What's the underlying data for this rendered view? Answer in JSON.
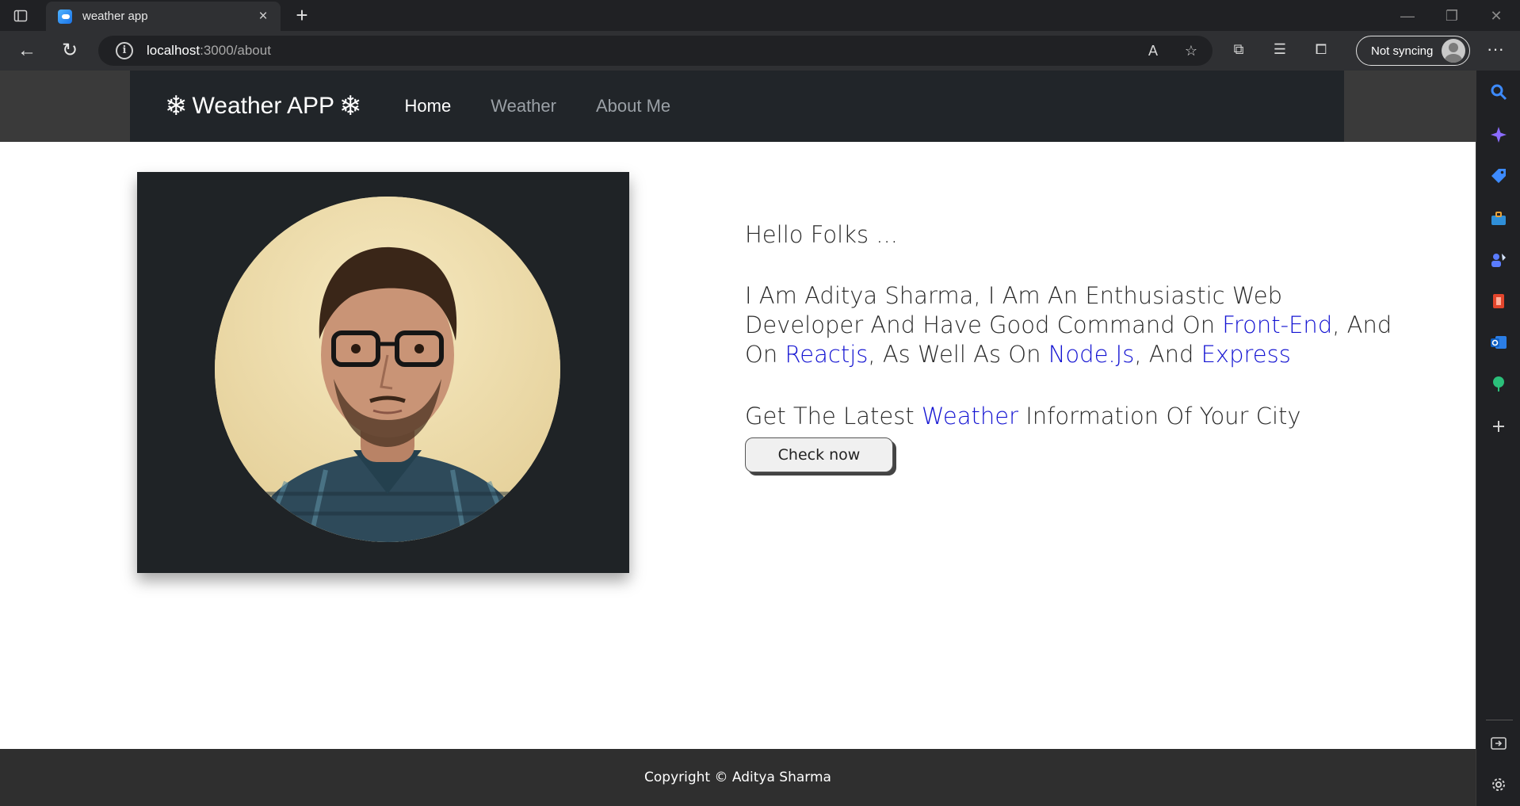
{
  "browser": {
    "tab_title": "weather app",
    "tab_close": "×",
    "new_tab": "+",
    "url_host": "localhost",
    "url_path": ":3000/about",
    "sync_label": "Not syncing",
    "more": "···"
  },
  "navbar": {
    "brand_flake": "❄",
    "brand_title": "Weather APP",
    "links": [
      {
        "label": "Home",
        "active": true
      },
      {
        "label": "Weather",
        "active": false
      },
      {
        "label": "About Me",
        "active": false
      }
    ]
  },
  "about": {
    "greeting": "Hello Folks ...",
    "bio": {
      "part1": "I Am Aditya Sharma, I Am An Enthusiastic Web Developer And Have Good Command On ",
      "tech1": "Front-End",
      "part2": ", And On ",
      "tech2": "Reactjs",
      "part3": ", As Well As On ",
      "tech3": "Node.Js",
      "part4": ", And ",
      "tech4": "Express"
    },
    "cta": {
      "prefix": "Get The Latest ",
      "highlight": "Weather",
      "suffix": " Information Of Your City"
    },
    "button_label": "Check now"
  },
  "footer": {
    "text": "Copyright © Aditya Sharma"
  },
  "colors": {
    "highlight": "#1414d2",
    "navbar_bg": "#212529",
    "footer_bg": "#2f2f2f"
  }
}
